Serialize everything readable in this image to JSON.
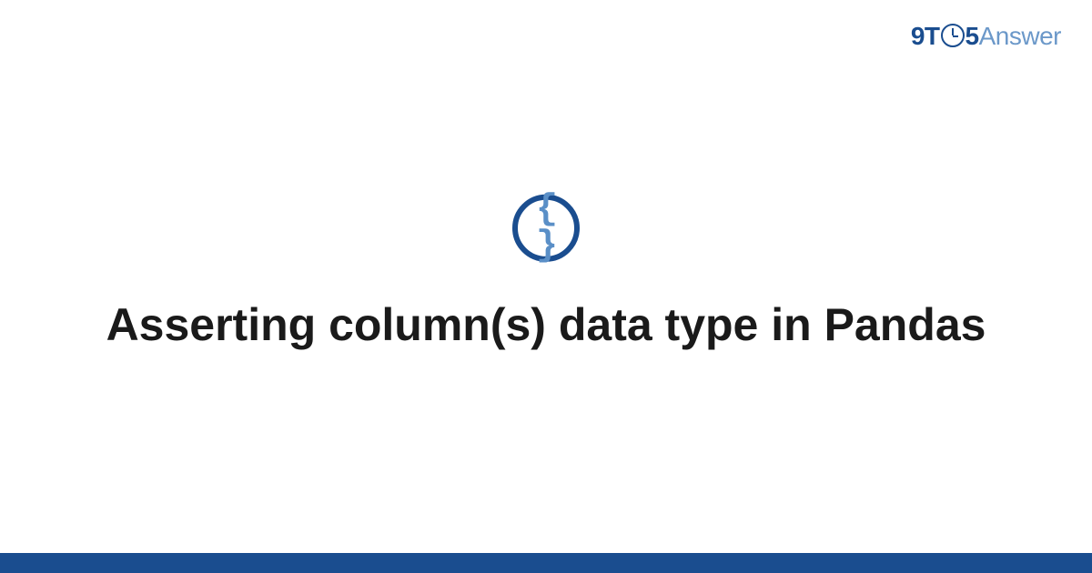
{
  "brand": {
    "part1": "9T",
    "part2": "5",
    "part3": "Answer"
  },
  "icon": {
    "glyph": "{ }"
  },
  "heading": "Asserting column(s) data type in Pandas",
  "colors": {
    "primary": "#1a4d8f",
    "secondary": "#6b98c9",
    "icon_inner": "#5a8fc7",
    "text": "#1a1a1a"
  }
}
